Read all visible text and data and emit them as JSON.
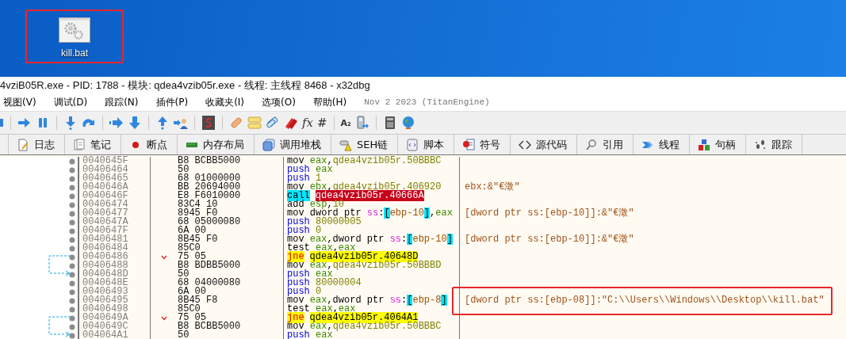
{
  "desktop": {
    "icons": [
      {
        "label": "kill.bat",
        "highlighted": true
      }
    ]
  },
  "window": {
    "title": "4vziB05R.exe - PID: 1788 - 模块: qdea4vzib05r.exe - 线程: 主线程 8468 - x32dbg"
  },
  "menu": {
    "items": [
      "视图(V)",
      "调试(D)",
      "跟踪(N)",
      "插件(P)",
      "收藏夹(I)",
      "选项(O)",
      "帮助(H)"
    ],
    "build_info": "Nov 2 2023 (TitanEngine)"
  },
  "toolbar": {
    "glyphs": [
      "fx",
      "#",
      "A₂"
    ]
  },
  "tabs": [
    {
      "label": "日志",
      "selected": false
    },
    {
      "label": "笔记",
      "selected": false
    },
    {
      "label": "断点",
      "selected": false
    },
    {
      "label": "内存布局",
      "selected": false
    },
    {
      "label": "调用堆栈",
      "selected": false
    },
    {
      "label": "SEH链",
      "selected": false
    },
    {
      "label": "脚本",
      "selected": false
    },
    {
      "label": "符号",
      "selected": false
    },
    {
      "label": "源代码",
      "selected": false
    },
    {
      "label": "引用",
      "selected": false
    },
    {
      "label": "线程",
      "selected": false
    },
    {
      "label": "句柄",
      "selected": false
    },
    {
      "label": "跟踪",
      "selected": false
    }
  ],
  "disassembly": {
    "rows": [
      {
        "address": "0040645F",
        "bytes": "B8 BCBB5000",
        "parts": [
          {
            "text": "mov ",
            "kind": "mnem"
          },
          {
            "text": "eax",
            "kind": "reg"
          },
          {
            "text": ",",
            "kind": "plain"
          },
          {
            "text": "qdea4vzib05r.50BBBC",
            "kind": "addr"
          }
        ]
      },
      {
        "address": "00406464",
        "bytes": "50",
        "parts": [
          {
            "text": "push ",
            "kind": "push"
          },
          {
            "text": "eax",
            "kind": "reg"
          }
        ]
      },
      {
        "address": "00406465",
        "bytes": "68 01000000",
        "parts": [
          {
            "text": "push ",
            "kind": "push"
          },
          {
            "text": "1",
            "kind": "num"
          }
        ]
      },
      {
        "address": "0040646A",
        "bytes": "BB 20694000",
        "parts": [
          {
            "text": "mov ",
            "kind": "mnem"
          },
          {
            "text": "ebx",
            "kind": "reg"
          },
          {
            "text": ",",
            "kind": "plain"
          },
          {
            "text": "qdea4vzib05r.406920",
            "kind": "addr"
          }
        ],
        "comment": "ebx:&\"€澂\""
      },
      {
        "address": "0040646F",
        "bytes": "E8 F6010000",
        "parts": [
          {
            "text": "call",
            "kind": "call"
          },
          {
            "text": "qdea4vzib05r.40666A",
            "kind": "calltarget"
          }
        ]
      },
      {
        "address": "00406474",
        "bytes": "83C4 10",
        "parts": [
          {
            "text": "add ",
            "kind": "mnem"
          },
          {
            "text": "esp",
            "kind": "reg"
          },
          {
            "text": ",",
            "kind": "plain"
          },
          {
            "text": "10",
            "kind": "num"
          }
        ]
      },
      {
        "address": "00406477",
        "bytes": "8945 F0",
        "parts": [
          {
            "text": "mov dword ptr ",
            "kind": "mnem"
          },
          {
            "text": "ss",
            "kind": "seg"
          },
          {
            "text": ":",
            "kind": "plain"
          },
          {
            "text": "[",
            "kind": "bracket"
          },
          {
            "text": "ebp-10",
            "kind": "expr"
          },
          {
            "text": "]",
            "kind": "bracket"
          },
          {
            "text": ",",
            "kind": "plain"
          },
          {
            "text": "eax",
            "kind": "reg"
          }
        ],
        "comment": "[dword ptr ss:[ebp-10]]:&\"€澂\""
      },
      {
        "address": "0040647A",
        "bytes": "68 05000080",
        "parts": [
          {
            "text": "push ",
            "kind": "push"
          },
          {
            "text": "80000005",
            "kind": "num"
          }
        ]
      },
      {
        "address": "0040647F",
        "bytes": "6A 00",
        "parts": [
          {
            "text": "push ",
            "kind": "push"
          },
          {
            "text": "0",
            "kind": "num"
          }
        ]
      },
      {
        "address": "00406481",
        "bytes": "8B45 F0",
        "parts": [
          {
            "text": "mov ",
            "kind": "mnem"
          },
          {
            "text": "eax",
            "kind": "reg"
          },
          {
            "text": ",dword ptr ",
            "kind": "plain"
          },
          {
            "text": "ss",
            "kind": "seg"
          },
          {
            "text": ":",
            "kind": "plain"
          },
          {
            "text": "[",
            "kind": "bracket"
          },
          {
            "text": "ebp-10",
            "kind": "expr"
          },
          {
            "text": "]",
            "kind": "bracket"
          }
        ],
        "comment": "[dword ptr ss:[ebp-10]]:&\"€澂\""
      },
      {
        "address": "00406484",
        "bytes": "85C0",
        "parts": [
          {
            "text": "test ",
            "kind": "mnem"
          },
          {
            "text": "eax",
            "kind": "reg"
          },
          {
            "text": ",",
            "kind": "plain"
          },
          {
            "text": "eax",
            "kind": "reg"
          }
        ]
      },
      {
        "address": "00406486",
        "bytes": "75 05",
        "jump_start": true,
        "parts": [
          {
            "text": "jne",
            "kind": "jump"
          },
          {
            "text": "qdea4vzib05r.40648D",
            "kind": "target"
          }
        ]
      },
      {
        "address": "00406488",
        "bytes": "B8 BDBB5000",
        "parts": [
          {
            "text": "mov ",
            "kind": "mnem"
          },
          {
            "text": "eax",
            "kind": "reg"
          },
          {
            "text": ",",
            "kind": "plain"
          },
          {
            "text": "qdea4vzib05r.50BBBD",
            "kind": "addr"
          }
        ]
      },
      {
        "address": "0040648D",
        "bytes": "50",
        "jump_target": true,
        "parts": [
          {
            "text": "push ",
            "kind": "push"
          },
          {
            "text": "eax",
            "kind": "reg"
          }
        ]
      },
      {
        "address": "0040648E",
        "bytes": "68 04000080",
        "parts": [
          {
            "text": "push ",
            "kind": "push"
          },
          {
            "text": "80000004",
            "kind": "num"
          }
        ]
      },
      {
        "address": "00406493",
        "bytes": "6A 00",
        "parts": [
          {
            "text": "push ",
            "kind": "push"
          },
          {
            "text": "0",
            "kind": "num"
          }
        ]
      },
      {
        "address": "00406495",
        "bytes": "8B45 F8",
        "parts": [
          {
            "text": "mov ",
            "kind": "mnem"
          },
          {
            "text": "eax",
            "kind": "reg"
          },
          {
            "text": ",dword ptr ",
            "kind": "plain"
          },
          {
            "text": "ss",
            "kind": "seg"
          },
          {
            "text": ":",
            "kind": "plain"
          },
          {
            "text": "[",
            "kind": "bracket"
          },
          {
            "text": "ebp-8",
            "kind": "expr"
          },
          {
            "text": "]",
            "kind": "bracket"
          }
        ],
        "comment": "[dword ptr ss:[ebp-08]]:\"C:\\\\Users\\\\Windows\\\\Desktop\\\\kill.bat\"",
        "highlighted": true
      },
      {
        "address": "00406498",
        "bytes": "85C0",
        "parts": [
          {
            "text": "test ",
            "kind": "mnem"
          },
          {
            "text": "eax",
            "kind": "reg"
          },
          {
            "text": ",",
            "kind": "plain"
          },
          {
            "text": "eax",
            "kind": "reg"
          }
        ]
      },
      {
        "address": "0040649A",
        "bytes": "75 05",
        "jump_start": true,
        "parts": [
          {
            "text": "jne",
            "kind": "jump"
          },
          {
            "text": "qdea4vzib05r.4064A1",
            "kind": "target"
          }
        ]
      },
      {
        "address": "0040649C",
        "bytes": "B8 BCBB5000",
        "parts": [
          {
            "text": "mov ",
            "kind": "mnem"
          },
          {
            "text": "eax",
            "kind": "reg"
          },
          {
            "text": ",",
            "kind": "plain"
          },
          {
            "text": "qdea4vzib05r.50BBBC",
            "kind": "addr"
          }
        ]
      },
      {
        "address": "004064A1",
        "bytes": "50",
        "jump_target": true,
        "parts": [
          {
            "text": "push ",
            "kind": "push"
          },
          {
            "text": "eax",
            "kind": "reg"
          }
        ]
      }
    ]
  }
}
